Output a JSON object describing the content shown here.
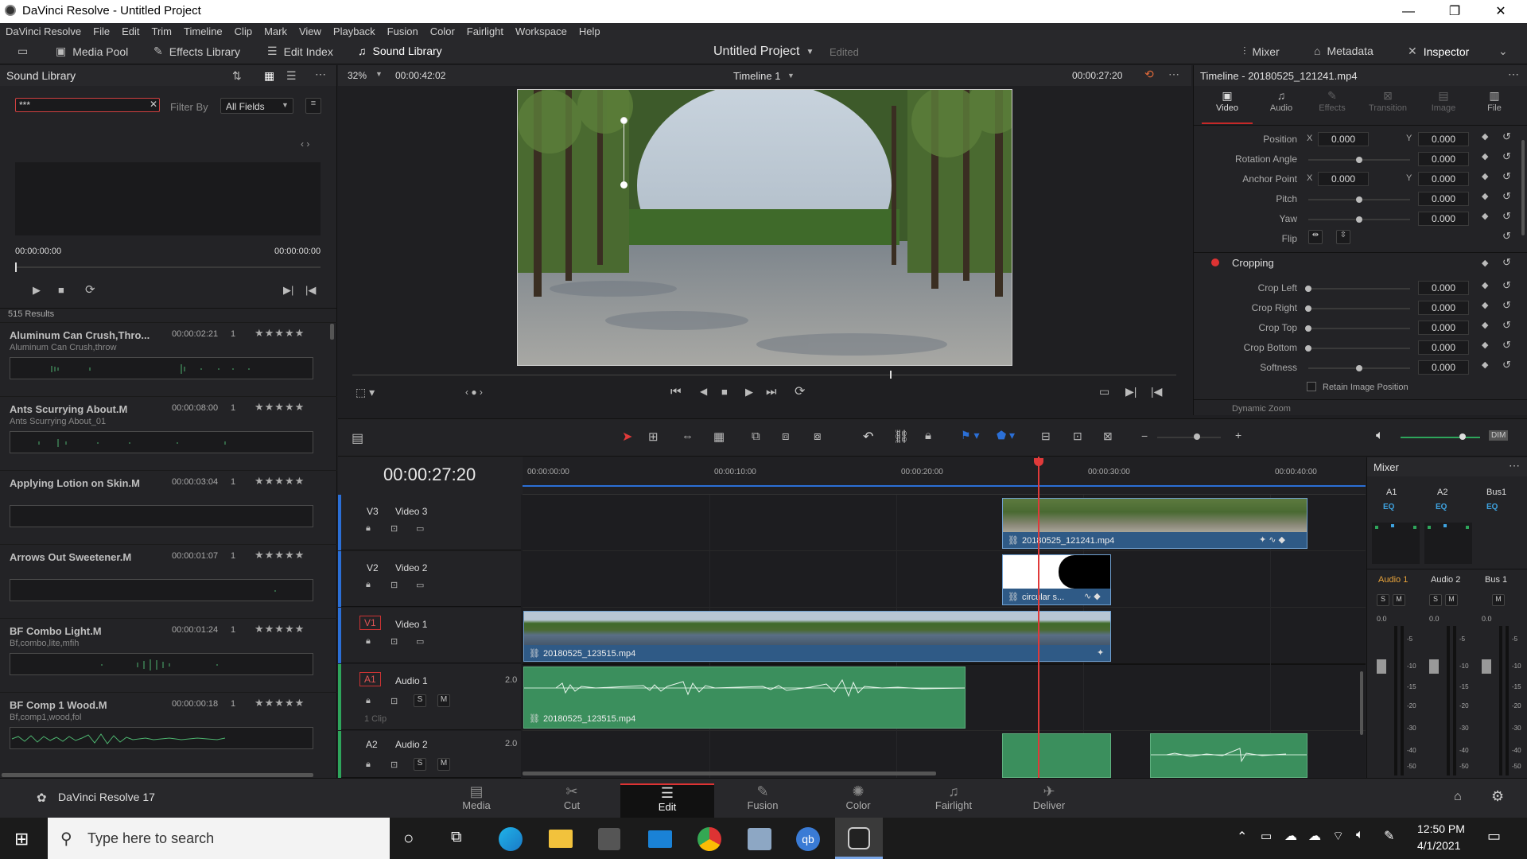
{
  "window": {
    "title": "DaVinci Resolve - Untitled Project",
    "minimize": "—",
    "maximize": "❐",
    "close": "✕"
  },
  "menu": [
    "DaVinci Resolve",
    "File",
    "Edit",
    "Trim",
    "Timeline",
    "Clip",
    "Mark",
    "View",
    "Playback",
    "Fusion",
    "Color",
    "Fairlight",
    "Workspace",
    "Help"
  ],
  "toolbar": {
    "media_pool": "Media Pool",
    "effects_library": "Effects Library",
    "edit_index": "Edit Index",
    "sound_library": "Sound Library",
    "project_title": "Untitled Project",
    "edited": "Edited",
    "mixer": "Mixer",
    "metadata": "Metadata",
    "inspector": "Inspector"
  },
  "sound_library": {
    "title": "Sound Library",
    "search_value": "***",
    "filter_by_label": "Filter By",
    "filter_by_value": "All Fields",
    "time_start": "00:00:00:00",
    "time_end": "00:00:00:00",
    "results": "515 Results",
    "items": [
      {
        "name": "Aluminum Can Crush,Thro...",
        "duration": "00:00:02:21",
        "count": "1",
        "stars": "★★★★★",
        "subtitle": "Aluminum Can Crush,throw"
      },
      {
        "name": "Ants Scurrying About.M",
        "duration": "00:00:08:00",
        "count": "1",
        "stars": "★★★★★",
        "subtitle": "Ants Scurrying About_01"
      },
      {
        "name": "Applying Lotion on Skin.M",
        "duration": "00:00:03:04",
        "count": "1",
        "stars": "★★★★★",
        "subtitle": ""
      },
      {
        "name": "Arrows Out Sweetener.M",
        "duration": "00:00:01:07",
        "count": "1",
        "stars": "★★★★★",
        "subtitle": ""
      },
      {
        "name": "BF Combo Light.M",
        "duration": "00:00:01:24",
        "count": "1",
        "stars": "★★★★★",
        "subtitle": "Bf,combo,lite,mfih"
      },
      {
        "name": "BF Comp 1 Wood.M",
        "duration": "00:00:00:18",
        "count": "1",
        "stars": "★★★★★",
        "subtitle": "Bf,comp1,wood,fol"
      }
    ]
  },
  "viewer": {
    "zoom": "32%",
    "duration": "00:00:42:02",
    "timeline_name": "Timeline 1",
    "timecode": "00:00:27:20"
  },
  "inspector": {
    "header": "Timeline - 20180525_121241.mp4",
    "tabs": [
      "Video",
      "Audio",
      "Effects",
      "Transition",
      "Image",
      "File"
    ],
    "transform": [
      {
        "label": "Position",
        "x": "0.000",
        "y": "0.000"
      },
      {
        "label": "Rotation Angle",
        "value": "0.000"
      },
      {
        "label": "Anchor Point",
        "x": "0.000",
        "y": "0.000"
      },
      {
        "label": "Pitch",
        "value": "0.000"
      },
      {
        "label": "Yaw",
        "value": "0.000"
      },
      {
        "label": "Flip"
      }
    ],
    "x_label": "X",
    "y_label": "Y",
    "cropping_title": "Cropping",
    "cropping": [
      {
        "label": "Crop Left",
        "value": "0.000"
      },
      {
        "label": "Crop Right",
        "value": "0.000"
      },
      {
        "label": "Crop Top",
        "value": "0.000"
      },
      {
        "label": "Crop Bottom",
        "value": "0.000"
      },
      {
        "label": "Softness",
        "value": "0.000"
      }
    ],
    "retain": "Retain Image Position",
    "dynamic_zoom": "Dynamic Zoom"
  },
  "timeline": {
    "timecode": "00:00:27:20",
    "ruler": [
      "00:00:00:00",
      "00:00:10:00",
      "00:00:20:00",
      "00:00:30:00",
      "00:00:40:00"
    ],
    "tracks": [
      {
        "id": "V3",
        "name": "Video 3"
      },
      {
        "id": "V2",
        "name": "Video 2"
      },
      {
        "id": "V1",
        "name": "Video 1"
      },
      {
        "id": "A1",
        "name": "Audio 1",
        "level": "2.0",
        "clips": "1 Clip"
      },
      {
        "id": "A2",
        "name": "Audio 2",
        "level": "2.0"
      }
    ],
    "clips": {
      "v3": "20180525_121241.mp4",
      "v2": "circular s...",
      "v1": "20180525_123515.mp4",
      "a1": "20180525_123515.mp4"
    },
    "solo": "S",
    "mute": "M"
  },
  "mixer": {
    "title": "Mixer",
    "channels": [
      {
        "top": "A1",
        "eq": "EQ",
        "name": "Audio 1",
        "level": "0.0"
      },
      {
        "top": "A2",
        "eq": "EQ",
        "name": "Audio 2",
        "level": "0.0"
      },
      {
        "top": "Bus1",
        "eq": "EQ",
        "name": "Bus 1",
        "level": "0.0"
      }
    ],
    "scale": [
      "-5",
      "-10",
      "-15",
      "-20",
      "-30",
      "-40",
      "-50"
    ]
  },
  "pages": {
    "app_name": "DaVinci Resolve 17",
    "items": [
      "Media",
      "Cut",
      "Edit",
      "Fusion",
      "Color",
      "Fairlight",
      "Deliver"
    ],
    "active": "Edit"
  },
  "taskbar": {
    "search_placeholder": "Type here to search",
    "time": "12:50 PM",
    "date": "4/1/2021"
  },
  "colors": {
    "accent": "#e8e8e8",
    "playhead": "#e03a3a",
    "video_clip": "#2f5a86",
    "audio_clip": "#3b8f5d"
  }
}
